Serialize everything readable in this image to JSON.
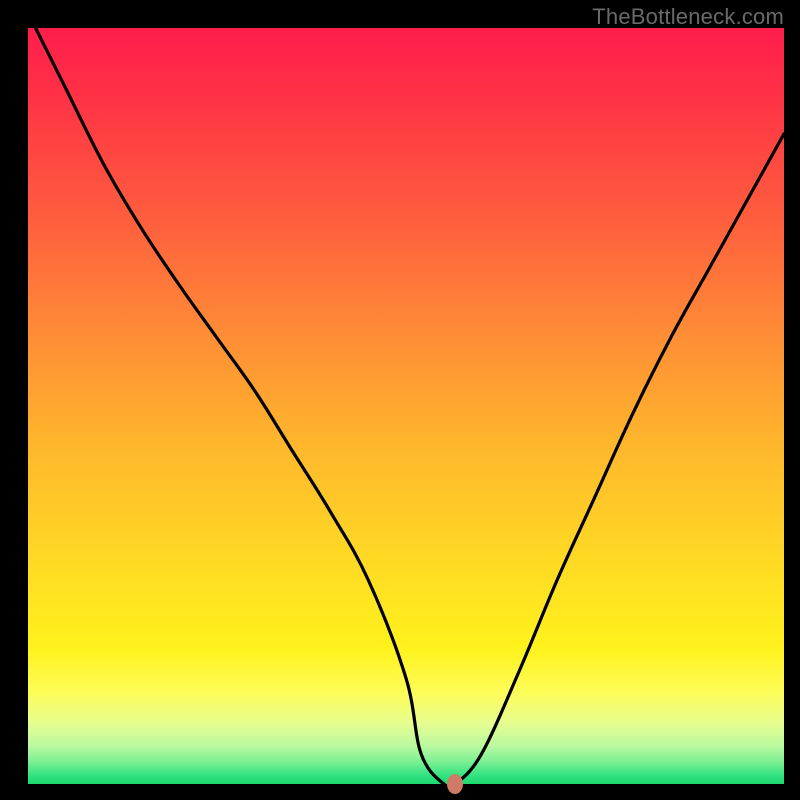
{
  "watermark": "TheBottleneck.com",
  "colors": {
    "background": "#000000",
    "curve": "#000000",
    "dot": "#d07b66"
  },
  "chart_data": {
    "type": "line",
    "title": "",
    "xlabel": "",
    "ylabel": "",
    "xlim": [
      0,
      100
    ],
    "ylim": [
      0,
      100
    ],
    "grid": false,
    "legend": false,
    "annotations": [
      {
        "text": "TheBottleneck.com",
        "position": "top-right"
      }
    ],
    "marker": {
      "x": 56.5,
      "y": 0,
      "color": "#d07b66"
    },
    "series": [
      {
        "name": "curve",
        "x": [
          1,
          5,
          10,
          15,
          20,
          25,
          30,
          35,
          40,
          45,
          50,
          52,
          55,
          56.5,
          60,
          65,
          70,
          75,
          80,
          85,
          90,
          95,
          100
        ],
        "y": [
          100,
          92,
          82,
          73.5,
          66,
          59,
          52,
          44,
          36,
          27,
          14,
          4,
          0,
          0,
          4,
          15,
          27,
          38,
          49,
          59,
          68,
          77,
          86
        ]
      }
    ],
    "background_gradient": {
      "direction": "vertical",
      "stops": [
        {
          "offset": 0.0,
          "color": "#ff1d4c"
        },
        {
          "offset": 0.25,
          "color": "#ff5d3e"
        },
        {
          "offset": 0.55,
          "color": "#ffb62c"
        },
        {
          "offset": 0.82,
          "color": "#fff21c"
        },
        {
          "offset": 0.95,
          "color": "#b8f9a0"
        },
        {
          "offset": 1.0,
          "color": "#1dd86f"
        }
      ]
    }
  }
}
